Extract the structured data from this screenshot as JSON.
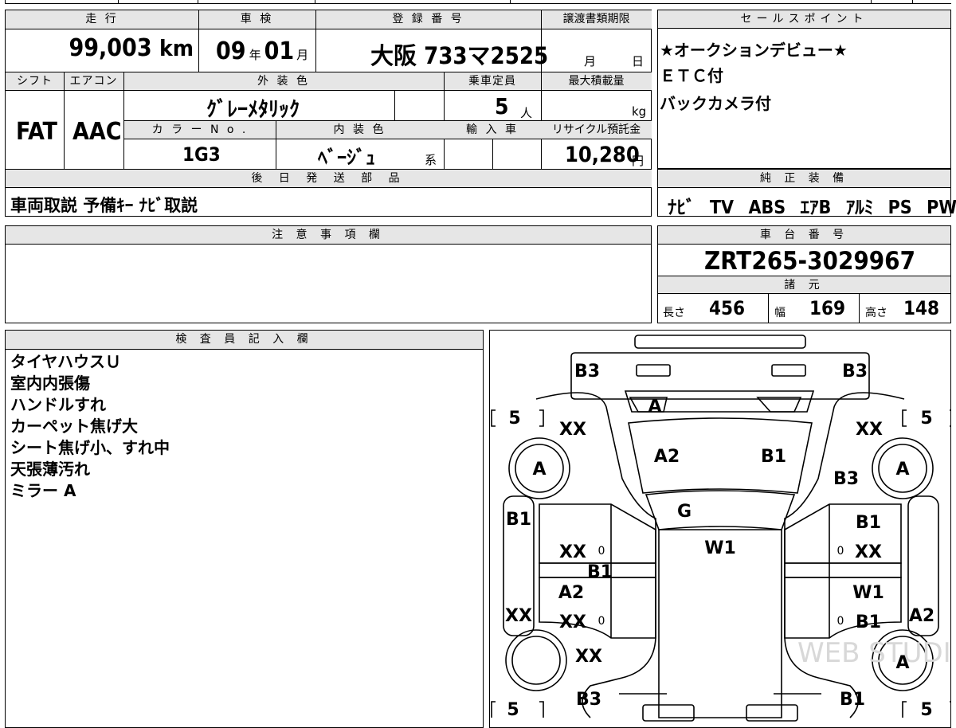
{
  "main": {
    "mileage_label": "走 行",
    "mileage_value": "99,003",
    "mileage_unit": "km",
    "inspection_label": "車 検",
    "inspection_year": "09",
    "inspection_year_unit": "年",
    "inspection_month": "01",
    "inspection_month_unit": "月",
    "registration_label": "登 録 番 号",
    "registration_value": "大阪 733マ2525",
    "transfer_label": "譲渡書類期限",
    "transfer_month_unit": "月",
    "transfer_day_unit": "日",
    "shift_label": "シフト",
    "shift_value": "FAT",
    "ac_label": "エアコン",
    "ac_value": "AAC",
    "exterior_color_label": "外 装 色",
    "exterior_color_value": "ｸﾞﾚｰﾒﾀﾘｯｸ",
    "capacity_label": "乗車定員",
    "capacity_value": "5",
    "capacity_unit": "人",
    "max_load_label": "最大積載量",
    "max_load_unit": "kg",
    "color_no_label": "カ ラ ー N o .",
    "color_no_value": "1G3",
    "interior_color_label": "内 装 色",
    "interior_color_value": "ﾍﾞｰｼﾞｭ",
    "interior_color_suffix": "系",
    "import_label": "輸 入 車",
    "recycle_label": "リサイクル預託金",
    "recycle_value": "10,280",
    "recycle_unit": "円",
    "later_parts_label": "後 日 発 送 部 品",
    "later_parts_value": "車両取説 予備ｷｰ ﾅﾋﾞ取説"
  },
  "sales": {
    "label": "セールスポイント",
    "items": [
      "★オークションデビュー★",
      "ＥＴＣ付",
      "バックカメラ付"
    ]
  },
  "equipment": {
    "label": "純 正 装 備",
    "items": [
      "ﾅﾋﾞ",
      "TV",
      "ABS",
      "ｴｱB",
      "ｱﾙﾐ",
      "PS",
      "PW"
    ]
  },
  "caution": {
    "label": "注 意 事 項 欄"
  },
  "chassis": {
    "label": "車 台 番 号",
    "value": "ZRT265-3029967"
  },
  "specs": {
    "label": "諸 元",
    "length_label": "長さ",
    "length_value": "456",
    "width_label": "幅",
    "width_value": "169",
    "height_label": "高さ",
    "height_value": "148"
  },
  "inspector": {
    "label": "検 査 員 記 入 欄",
    "notes": [
      "タイヤハウスＵ",
      "室内内張傷",
      "ハンドルすれ",
      "カーペット焦げ大",
      "シート焦げ小、すれ中",
      "天張薄汚れ",
      "ミラー A"
    ]
  },
  "diagram": {
    "marks": {
      "rear_left": "B3",
      "rear_right": "B3",
      "top_a": "A",
      "tire_fl": "5",
      "tire_fr": "5",
      "tire_rl": "5",
      "tire_rr": "5",
      "fl_fender": "XX",
      "fr_fender": "XX",
      "fl_wheel": "A",
      "fr_wheel": "A",
      "glass_a2": "A2",
      "glass_b1": "B1",
      "fr_b3": "B3",
      "roof_g": "G",
      "roof_w1": "W1",
      "left_b1": "B1",
      "left_xx1": "XX",
      "left_b1b": "B1",
      "left_a2": "A2",
      "left_xx_edge": "XX",
      "left_xx2": "XX",
      "right_b1": "B1",
      "right_xx1": "XX",
      "right_w1": "W1",
      "right_b1b": "B1",
      "right_a2_edge": "A2",
      "zero1": "0",
      "zero2": "0",
      "zero3": "0",
      "zero4": "0",
      "rl_xx": "XX",
      "rr_wheel": "A",
      "front_left": "B3",
      "front_right": "B1"
    },
    "watermark": "WEB STUDIO PLUS"
  }
}
